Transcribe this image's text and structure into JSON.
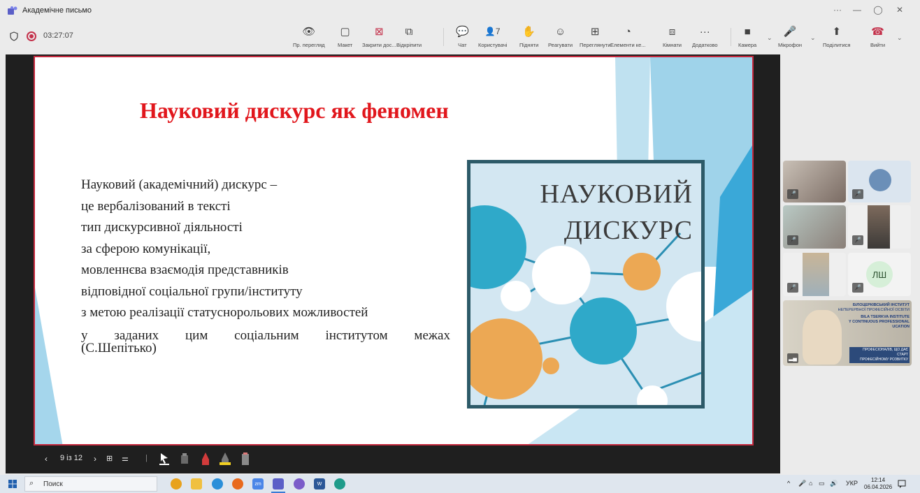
{
  "window": {
    "title": "Академічне письмо",
    "controls": {
      "more": "···",
      "minimize": "—",
      "restore": "◯",
      "close": "✕"
    }
  },
  "meeting": {
    "timer": "03:27:07",
    "toolbar": [
      {
        "label": "Пр. перегляд",
        "icon": "eye-icon",
        "glyph": "👁"
      },
      {
        "label": "Макет",
        "icon": "layout-icon",
        "glyph": "▢"
      },
      {
        "label": "Закрити дос...",
        "icon": "close-share-icon",
        "glyph": "⊠"
      },
      {
        "label": "Відкріпити",
        "icon": "popout-icon",
        "glyph": "⧉"
      },
      {
        "label": "Чат",
        "icon": "chat-icon",
        "glyph": "💬"
      },
      {
        "label": "Користувачі",
        "icon": "people-icon",
        "glyph": "👤7"
      },
      {
        "label": "Підняти",
        "icon": "raise-hand-icon",
        "glyph": "✋"
      },
      {
        "label": "Реагувати",
        "icon": "react-icon",
        "glyph": "☺"
      },
      {
        "label": "Переглянути",
        "icon": "view-icon",
        "glyph": "⊞"
      },
      {
        "label": "Елементи ке...",
        "icon": "apps-icon",
        "glyph": "◔"
      },
      {
        "label": "Кімнати",
        "icon": "rooms-icon",
        "glyph": "⧈"
      },
      {
        "label": "Додатково",
        "icon": "more-icon",
        "glyph": "···"
      },
      {
        "label": "Камера",
        "icon": "camera-icon",
        "glyph": "■"
      },
      {
        "label": "Мікрофон",
        "icon": "microphone-icon",
        "glyph": "🎤"
      },
      {
        "label": "Поділитися",
        "icon": "share-icon",
        "glyph": "⬆"
      },
      {
        "label": "Вийти",
        "icon": "leave-call-icon",
        "glyph": "☎"
      }
    ]
  },
  "slide": {
    "title": "Науковий дискурс як феномен",
    "lines": [
      "Науковий (академічний) дискурс –",
      "це вербалізований в тексті",
      "тип дискурсивної діяльності",
      "за сферою комунікації,",
      "мовленнєва взаємодія представників",
      "відповідної соціальної групи/інституту",
      "з метою реалізації статуснорольових можливостей"
    ],
    "last_line_words": [
      "у",
      "заданих",
      "цим",
      "соціальним",
      "інститутом",
      "межах"
    ],
    "citation": "(С.Шепітько)",
    "picture_line1": "НАУКОВИЙ",
    "picture_line2": "ДИСКУРС",
    "counter": "9 із 12"
  },
  "participants": {
    "initials_tile": "ЛШ",
    "banner_line1": "БІЛОЦЕРКІВСЬКИЙ ІНСТИТУТ",
    "banner_line2": "НЕПЕРЕРВНОЇ ПРОФЕСІЙНОЇ ОСВІТИ",
    "banner_line3": "BILA TSERKVA INSTITUTE",
    "banner_line4": "Y CONTINUOUS PROFESSIONAL",
    "banner_line5": "UCATION",
    "banner_line6": "ПРОФЕСІОНАЛІВ, ЩО ДАЄ СТАРТ",
    "banner_line7": "ПРОФЕСІЙНОМУ РОЗВИТКУ"
  },
  "taskbar": {
    "search_placeholder": "Поиск",
    "language": "УКР",
    "time": "12:14",
    "date": "06.04.2026"
  },
  "colors": {
    "slide_title": "#e1161c",
    "slide_border": "#c5283d",
    "record": "#c4314b",
    "leave": "#c4314b"
  }
}
